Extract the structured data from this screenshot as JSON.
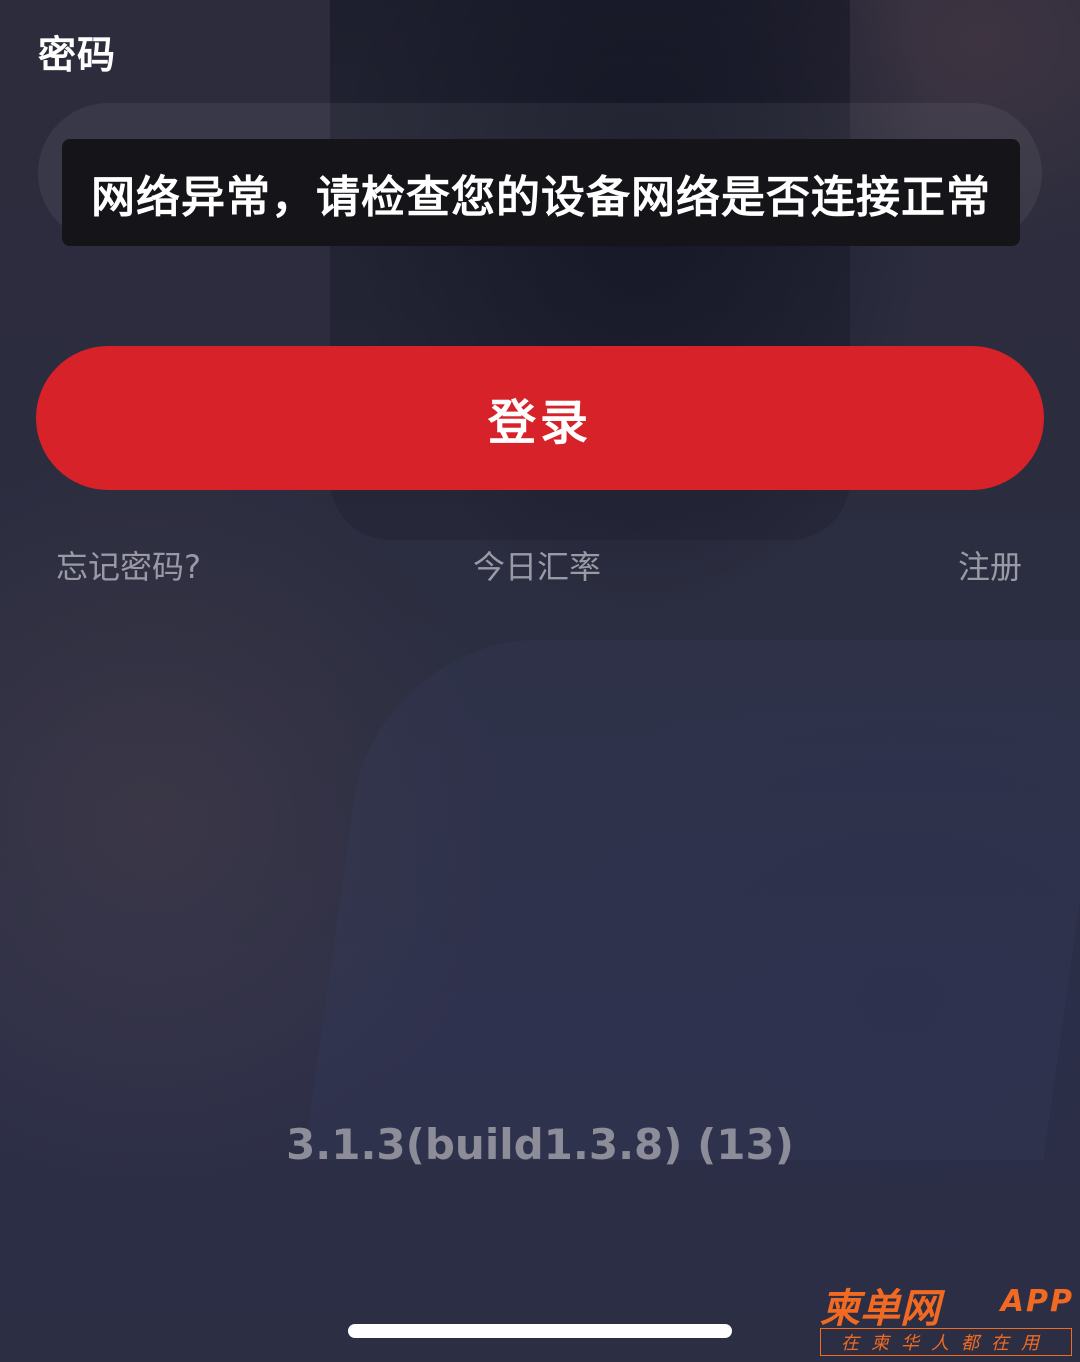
{
  "password_label": "密码",
  "toast_message": "网络异常，请检查您的设备网络是否连接正常",
  "login_button": "登录",
  "links": {
    "forgot_password": "忘记密码?",
    "exchange_rate": "今日汇率",
    "register": "注册"
  },
  "version": "3.1.3(build1.3.8) (13)",
  "watermark": {
    "brand": "柬单网",
    "app": "APP",
    "slogan": "在柬华人都在用"
  },
  "colors": {
    "primary_button": "#d82229",
    "watermark": "#f26a21"
  }
}
